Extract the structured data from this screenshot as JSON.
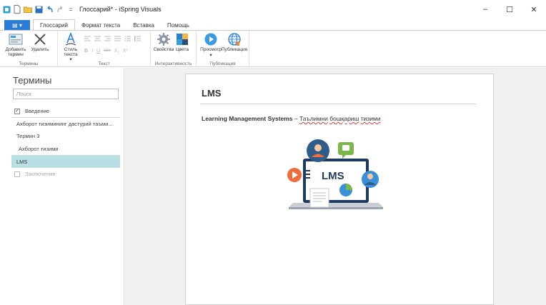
{
  "window": {
    "title": "Глоссарий* - iSpring Visuals",
    "minimize": "–",
    "maximize": "☐",
    "close": "✕"
  },
  "quick_access": {
    "icons": [
      "app-icon",
      "new-file-icon",
      "open-folder-icon",
      "save-icon",
      "undo-icon",
      "redo-icon",
      "customize-icon"
    ],
    "customize": "="
  },
  "tabs": {
    "file": "▤ ▾",
    "items": [
      "Глоссарий",
      "Формат текста",
      "Вставка",
      "Помощь"
    ],
    "active": 0
  },
  "ribbon": {
    "terms_group": {
      "label": "Термины",
      "add": "Добавить термин",
      "delete": "Удалить"
    },
    "text_group": {
      "label": "Текст",
      "style": "Стиль текста ▾",
      "format_buttons": [
        "B",
        "I",
        "U",
        "abc",
        "X₁",
        "X¹"
      ]
    },
    "interactivity_group": {
      "label": "Интерактивность",
      "properties": "Свойства",
      "colors": "Цвета"
    },
    "publish_group": {
      "label": "Публикация",
      "preview": "Просмотр",
      "publish": "Публикация"
    }
  },
  "left_panel": {
    "title": "Термины",
    "search_placeholder": "Поиск",
    "intro": "Введение",
    "terms": [
      "Ахборот тизимининг дастурий таъми...",
      "Термин 3",
      "Ахборот тизими",
      "LMS"
    ],
    "selected_index": 3,
    "conclusion": "Заключение"
  },
  "page": {
    "title": "LMS",
    "definition_term": "Learning Management Systems",
    "definition_sep": " – ",
    "definition_words": [
      "Таълимни",
      "бошқариш",
      "тизими"
    ],
    "illustration_label": "LMS"
  },
  "colors": {
    "accent": "#2b7cd3",
    "selection": "#b9dee3",
    "illus_orange": "#f26b3a",
    "illus_green": "#7ab648",
    "illus_blue": "#3b8fd6",
    "illus_navy": "#1f3a5f"
  }
}
